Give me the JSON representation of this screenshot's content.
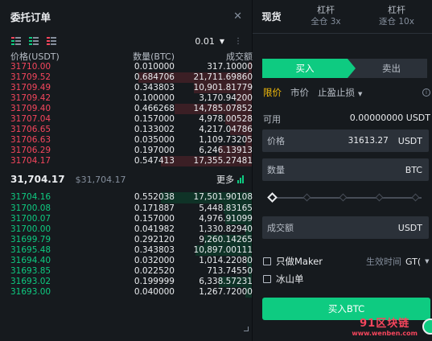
{
  "orderbook": {
    "title": "委托订单",
    "precision": "0.01",
    "columns": {
      "price": "价格(USDT)",
      "qty": "数量(BTC)",
      "total": "成交额"
    },
    "asks": [
      {
        "price": "31710.00",
        "qty": "0.010000",
        "total": "317.10000",
        "depth": 0.02
      },
      {
        "price": "31709.52",
        "qty": "0.684706",
        "total": "21,711.69860",
        "depth": 0.69
      },
      {
        "price": "31709.49",
        "qty": "0.343803",
        "total": "10,901.81779",
        "depth": 0.35
      },
      {
        "price": "31709.42",
        "qty": "0.100000",
        "total": "3,170.94200",
        "depth": 0.1
      },
      {
        "price": "31709.40",
        "qty": "0.466268",
        "total": "14,785.07852",
        "depth": 0.47
      },
      {
        "price": "31707.04",
        "qty": "0.157000",
        "total": "4,978.00528",
        "depth": 0.16
      },
      {
        "price": "31706.65",
        "qty": "0.133002",
        "total": "4,217.04786",
        "depth": 0.13
      },
      {
        "price": "31706.63",
        "qty": "0.035000",
        "total": "1,109.73205",
        "depth": 0.04
      },
      {
        "price": "31706.29",
        "qty": "0.197000",
        "total": "6,246.13913",
        "depth": 0.2
      },
      {
        "price": "31704.17",
        "qty": "0.547413",
        "total": "17,355.27481",
        "depth": 0.55
      }
    ],
    "last_price": "31,704.17",
    "mark_price": "$31,704.17",
    "more_label": "更多",
    "bids": [
      {
        "price": "31704.16",
        "qty": "0.552038",
        "total": "17,501.90108",
        "depth": 0.55
      },
      {
        "price": "31700.08",
        "qty": "0.171887",
        "total": "5,448.83165",
        "depth": 0.17
      },
      {
        "price": "31700.07",
        "qty": "0.157000",
        "total": "4,976.91099",
        "depth": 0.16
      },
      {
        "price": "31700.00",
        "qty": "0.041982",
        "total": "1,330.82940",
        "depth": 0.04
      },
      {
        "price": "31699.79",
        "qty": "0.292120",
        "total": "9,260.14265",
        "depth": 0.29
      },
      {
        "price": "31695.48",
        "qty": "0.343803",
        "total": "10,897.00111",
        "depth": 0.34
      },
      {
        "price": "31694.40",
        "qty": "0.032000",
        "total": "1,014.22080",
        "depth": 0.03
      },
      {
        "price": "31693.85",
        "qty": "0.022520",
        "total": "713.74550",
        "depth": 0.02
      },
      {
        "price": "31693.02",
        "qty": "0.199999",
        "total": "6,338.57231",
        "depth": 0.2
      },
      {
        "price": "31693.00",
        "qty": "0.040000",
        "total": "1,267.72000",
        "depth": 0.04
      }
    ]
  },
  "trade": {
    "tabs": [
      {
        "label": "现货",
        "sub": ""
      },
      {
        "label": "杠杆",
        "sub": "全仓 3x"
      },
      {
        "label": "杠杆",
        "sub": "逐仓 10x"
      }
    ],
    "buy_tab": "买入",
    "sell_tab": "卖出",
    "order_types": [
      "限价",
      "市价",
      "止盈止损"
    ],
    "available_label": "可用",
    "available_value": "0.00000000 USDT",
    "price_label": "价格",
    "price_value": "31613.27",
    "price_unit": "USDT",
    "qty_label": "数量",
    "qty_unit": "BTC",
    "total_label": "成交额",
    "total_unit": "USDT",
    "maker_label": "只做Maker",
    "tif_label": "生效时间",
    "tif_value": "GT(",
    "iceberg_label": "冰山单",
    "buy_button": "买入BTC"
  },
  "watermark": {
    "line1": "91区块链",
    "line2": "www.wenben.com"
  },
  "colors": {
    "ask": "#f6465d",
    "bid": "#0ecb81",
    "accent": "#f0b90b",
    "panel": "#161a1e"
  }
}
